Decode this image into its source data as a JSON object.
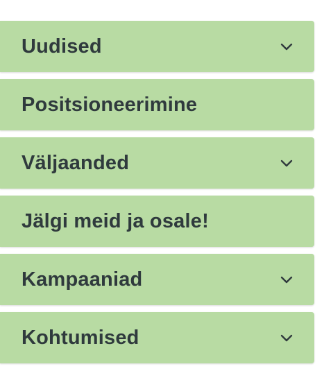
{
  "menu": {
    "items": [
      {
        "label": "Uudised",
        "has_submenu": true,
        "icon": "chevron-down-icon"
      },
      {
        "label": "Positsioneerimine",
        "has_submenu": false
      },
      {
        "label": "Väljaanded",
        "has_submenu": true,
        "icon": "chevron-down-icon"
      },
      {
        "label": "Jälgi meid ja osale!",
        "has_submenu": false
      },
      {
        "label": "Kampaaniad",
        "has_submenu": true,
        "icon": "chevron-down-icon"
      },
      {
        "label": "Kohtumised",
        "has_submenu": true,
        "icon": "chevron-down-icon"
      }
    ]
  },
  "colors": {
    "item_background": "#b8dba3",
    "text": "#2f3a3d"
  }
}
